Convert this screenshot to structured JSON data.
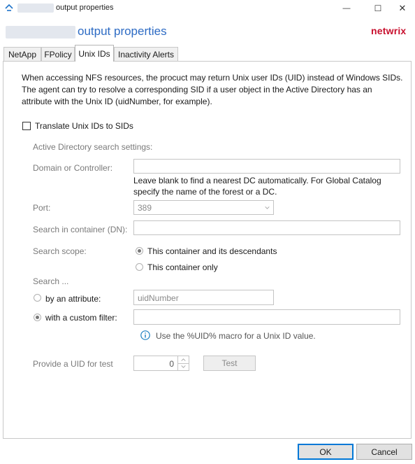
{
  "window": {
    "title": "output properties",
    "minimize_symbol": "—",
    "maximize_symbol": "☐",
    "close_symbol": "✕"
  },
  "header": {
    "title": "output properties",
    "logo_text": "netwrix"
  },
  "tabs": [
    {
      "label": "NetApp",
      "active": false
    },
    {
      "label": "FPolicy",
      "active": false
    },
    {
      "label": "Unix IDs",
      "active": true
    },
    {
      "label": "Inactivity Alerts",
      "active": false
    }
  ],
  "description": {
    "line1": "When accessing NFS resources, the procuct may return Unix user IDs (UID) instead of Windows SIDs.",
    "line2": "The agent can try to resolve a corresponding SID if a user object in the Active Directory has an",
    "line3": "attribute with the Unix ID (uidNumber, for example)."
  },
  "translate_checkbox": {
    "label": "Translate Unix IDs to SIDs",
    "checked": false
  },
  "ad_settings": {
    "heading": "Active Directory search settings:",
    "domain_label": "Domain or Controller:",
    "domain_value": "",
    "domain_hint_line1": "Leave blank to find a nearest DC automatically. For Global Catalog",
    "domain_hint_line2": "specify the name of the forest or a DC.",
    "port_label": "Port:",
    "port_value": "389",
    "container_label": "Search in container (DN):",
    "container_value": "",
    "scope_label": "Search scope:",
    "scope_options": [
      {
        "label": "This container and its descendants",
        "checked": true
      },
      {
        "label": "This container only",
        "checked": false
      }
    ],
    "search_label": "Search ...",
    "by_attribute_label": "by an attribute:",
    "by_attribute_checked": false,
    "attribute_value": "uidNumber",
    "custom_filter_label": "with a custom filter:",
    "custom_filter_checked": true,
    "custom_filter_value": "",
    "info_text": "Use the %UID% macro for a Unix ID value.",
    "uid_label": "Provide a UID for test",
    "uid_value": "0",
    "test_button": "Test"
  },
  "footer": {
    "ok_label": "OK",
    "cancel_label": "Cancel"
  },
  "colors": {
    "accent": "#2d6bc4",
    "brand": "#c8102e",
    "info_icon": "#1a7fc1"
  }
}
